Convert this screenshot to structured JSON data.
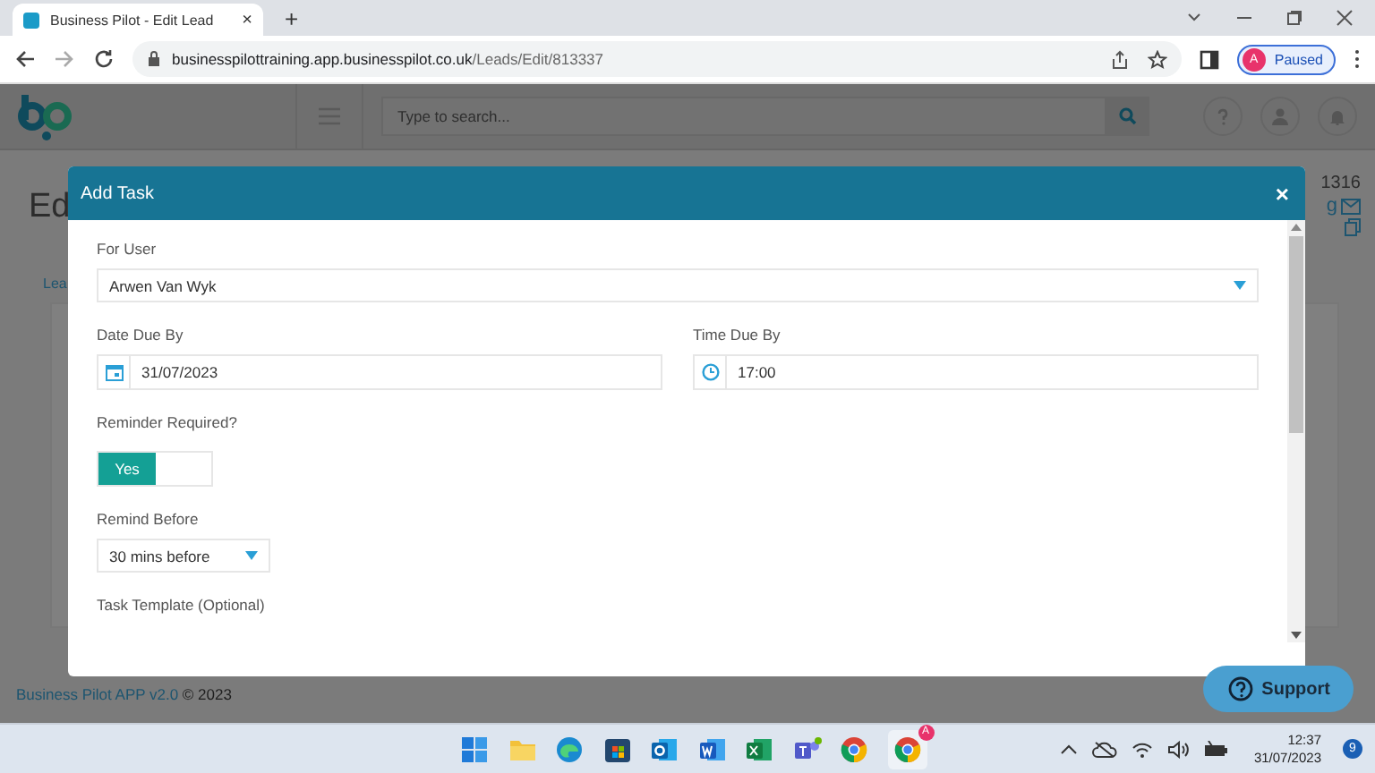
{
  "browser": {
    "tab": {
      "title": "Business Pilot - Edit Lead",
      "close": "×"
    },
    "new_tab": "+",
    "address": {
      "host": "businesspilottraining.app.businesspilot.co.uk",
      "path": "/Leads/Edit/813337"
    },
    "profile": {
      "initial": "A",
      "status": "Paused"
    }
  },
  "app_header": {
    "search": {
      "placeholder": "Type to search..."
    }
  },
  "page": {
    "title": "Ed",
    "tab": "Lea",
    "lead_number": "1316",
    "email_fragment": "g",
    "footer": {
      "link": "Business Pilot APP v2.0",
      "text": "© 2023"
    }
  },
  "modal": {
    "title": "Add Task",
    "close": "×",
    "for_user": {
      "label": "For User",
      "value": "Arwen Van Wyk"
    },
    "date_due": {
      "label": "Date Due By",
      "value": "31/07/2023"
    },
    "time_due": {
      "label": "Time Due By",
      "value": "17:00"
    },
    "reminder": {
      "label": "Reminder Required?",
      "toggle_label": "Yes",
      "on": true
    },
    "remind_before": {
      "label": "Remind Before",
      "value": "30 mins before"
    },
    "task_template": {
      "label": "Task Template (Optional)"
    }
  },
  "support_button": "Support",
  "taskbar": {
    "chrome_badge": "A",
    "time": "12:37",
    "date": "31/07/2023",
    "notification_count": "9"
  }
}
